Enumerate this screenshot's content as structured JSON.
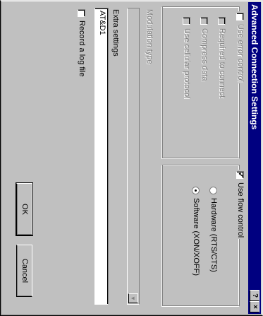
{
  "window": {
    "title": "Advanced Connection Settings",
    "help_label": "?",
    "close_label": "×"
  },
  "error_group": {
    "checkbox_label": "Use error control",
    "options": [
      "Required to connect",
      "Compress data",
      "Use cellular protocol"
    ]
  },
  "modulation": {
    "label": "Modulation type",
    "value": ""
  },
  "extra_settings": {
    "label": "Extra settings",
    "value": "AT&D1"
  },
  "log": {
    "label": "Record a log file"
  },
  "flow": {
    "checkbox_label": "Use flow control",
    "checked": true,
    "hardware_label": "Hardware (RTS/CTS)",
    "software_label": "Software (XON/XOFF)",
    "selected": "software"
  },
  "buttons": {
    "ok": "OK",
    "cancel": "Cancel"
  }
}
